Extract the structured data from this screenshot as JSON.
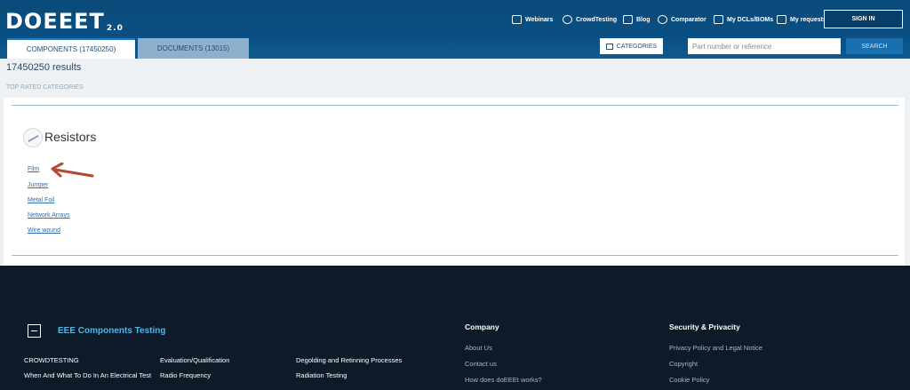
{
  "header": {
    "logo": "DOEEET",
    "logo_version": "2.0",
    "nav": [
      {
        "label": "Webinars",
        "icon": "monitor-icon"
      },
      {
        "label": "CrowdTesting",
        "icon": "lightbulb-icon"
      },
      {
        "label": "Blog",
        "icon": "document-icon"
      },
      {
        "label": "Comparator",
        "icon": "compare-icon"
      },
      {
        "label": "My DCLs/BOMs",
        "icon": "list-icon"
      },
      {
        "label": "My requests",
        "icon": "file-icon"
      }
    ],
    "signin_label": "SIGN IN",
    "tabs": [
      {
        "label": "COMPONENTS (17450250)",
        "active": true
      },
      {
        "label": "DOCUMENTS (13015)",
        "active": false
      }
    ],
    "categories_label": "CATEGORIES",
    "search_placeholder": "Part number or reference",
    "search_label": "SEARCH"
  },
  "main": {
    "results_text": "17450250 results",
    "top_rated_label": "TOP RATED CATEGORIES",
    "category": {
      "title": "Resistors",
      "subcategories": [
        "Film",
        "Jumper",
        "Metal Foil",
        "Network Arrays",
        "Wire wound"
      ]
    }
  },
  "footer": {
    "brand": "EEE Components Testing",
    "links_col1": [
      "CROWDTESTING",
      "When And What To Do In An Electrical Test"
    ],
    "links_col2": [
      "Evaluation/Qualification",
      "Radio Frequency"
    ],
    "links_col3": [
      "Degolding and Retinning Processes",
      "Radiation Testing"
    ],
    "company": {
      "heading": "Company",
      "items": [
        "About Us",
        "Contact us",
        "How does doEEEt works?"
      ]
    },
    "security": {
      "heading": "Security & Privacity",
      "items": [
        "Privacy Policy and Legal Notice",
        "Copyright",
        "Cookie Policy"
      ]
    }
  },
  "colors": {
    "header_bg": "#0b4f82",
    "accent": "#4bb8e8",
    "arrow": "#b24a34",
    "footer_bg": "#0e1a28"
  }
}
